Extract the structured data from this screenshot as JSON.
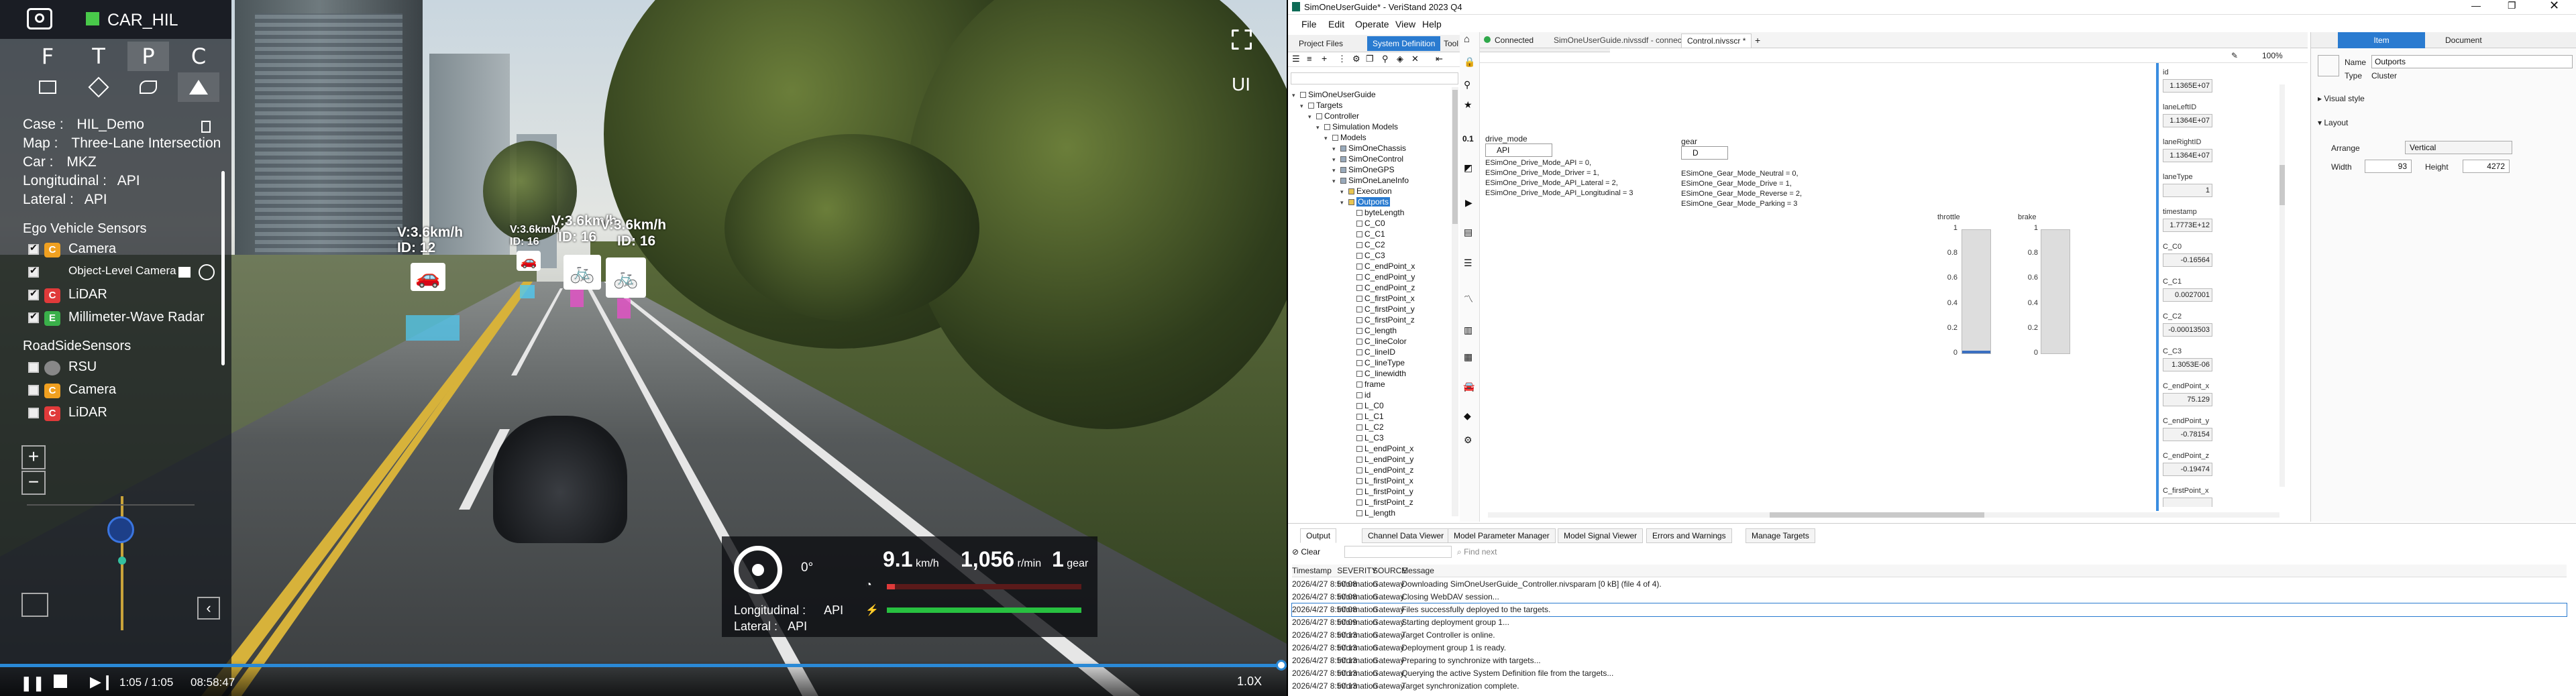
{
  "sim": {
    "camera_name": "CAR_HIL",
    "modes": [
      "F",
      "T",
      "P",
      "C"
    ],
    "info": {
      "case_label": "Case :",
      "case_value": "HIL_Demo",
      "map_label": "Map :",
      "map_value": "Three-Lane Intersection",
      "car_label": "Car :",
      "car_value": "MKZ",
      "long_label": "Longitudinal :",
      "long_value": "API",
      "lat_label": "Lateral :",
      "lat_value": "API"
    },
    "ego_sensors_title": "Ego Vehicle Sensors",
    "ego_sensors": [
      {
        "label": "Camera",
        "checked": true,
        "badge": "C",
        "color": "#f0a020"
      },
      {
        "label": "Object-Level Camera",
        "checked": true,
        "badge": "",
        "color": ""
      },
      {
        "label": "LiDAR",
        "checked": true,
        "badge": "C",
        "color": "#e03a3a"
      },
      {
        "label": "Millimeter-Wave Radar",
        "checked": true,
        "badge": "E",
        "color": "#3ab04a"
      }
    ],
    "roadside_title": "RoadSideSensors",
    "roadside_sensors": [
      {
        "label": "RSU",
        "checked": false,
        "badge": "",
        "color": "#888"
      },
      {
        "label": "Camera",
        "checked": false,
        "badge": "C",
        "color": "#f0a020"
      },
      {
        "label": "LiDAR",
        "checked": false,
        "badge": "C",
        "color": "#e03a3a"
      }
    ],
    "vehicle_tags": [
      {
        "speed": "V:3.6km/h",
        "id": "ID:  12"
      },
      {
        "speed": "V:3.6km/h",
        "id": "ID:  16"
      },
      {
        "speed": "V:3.6km/h",
        "id": "ID:  16"
      },
      {
        "speed": "V:3.6km/h",
        "id": "ID:  16"
      }
    ],
    "ui_label": "UI",
    "hud": {
      "steer_angle": "0°",
      "long_label": "Longitudinal :",
      "long_value": "API",
      "lat_label": "Lateral :",
      "lat_value": "API",
      "speed": "9.1",
      "speed_unit": "km/h",
      "rpm": "1,056",
      "rpm_unit": "r/min",
      "gear": "1",
      "gear_unit": "gear"
    },
    "playback": {
      "time": "1:05 / 1:05",
      "clock": "08:58:47",
      "rate": "1.0X",
      "progress": 1.0
    }
  },
  "vs": {
    "title": "SimOneUserGuide* - VeriStand 2023 Q4",
    "menu": [
      "File",
      "Edit",
      "Operate",
      "View",
      "Help"
    ],
    "left_tabs": [
      "Project Files",
      "System Definition",
      "Tool Launcher"
    ],
    "doc_tabs": {
      "connected": "Connected",
      "sysdef": "SimOneUserGuide.nivssdf - connected",
      "screen": "Control.nivsscr *"
    },
    "zoom": "100%",
    "tree": [
      {
        "label": "SimOneUserGuide",
        "level": 0
      },
      {
        "label": "Targets",
        "level": 1
      },
      {
        "label": "Controller",
        "level": 2
      },
      {
        "label": "Simulation Models",
        "level": 3
      },
      {
        "label": "Models",
        "level": 4
      },
      {
        "label": "SimOneChassis",
        "level": 5
      },
      {
        "label": "SimOneControl",
        "level": 5
      },
      {
        "label": "SimOneGPS",
        "level": 5
      },
      {
        "label": "SimOneLaneInfo",
        "level": 5
      },
      {
        "label": "Execution",
        "level": 6
      },
      {
        "label": "Outports",
        "level": 6,
        "selected": true
      },
      {
        "label": "byteLength",
        "level": 7
      },
      {
        "label": "C_C0",
        "level": 7
      },
      {
        "label": "C_C1",
        "level": 7
      },
      {
        "label": "C_C2",
        "level": 7
      },
      {
        "label": "C_C3",
        "level": 7
      },
      {
        "label": "C_endPoint_x",
        "level": 7
      },
      {
        "label": "C_endPoint_y",
        "level": 7
      },
      {
        "label": "C_endPoint_z",
        "level": 7
      },
      {
        "label": "C_firstPoint_x",
        "level": 7
      },
      {
        "label": "C_firstPoint_y",
        "level": 7
      },
      {
        "label": "C_firstPoint_z",
        "level": 7
      },
      {
        "label": "C_length",
        "level": 7
      },
      {
        "label": "C_lineColor",
        "level": 7
      },
      {
        "label": "C_lineID",
        "level": 7
      },
      {
        "label": "C_lineType",
        "level": 7
      },
      {
        "label": "C_linewidth",
        "level": 7
      },
      {
        "label": "frame",
        "level": 7
      },
      {
        "label": "id",
        "level": 7
      },
      {
        "label": "L_C0",
        "level": 7
      },
      {
        "label": "L_C1",
        "level": 7
      },
      {
        "label": "L_C2",
        "level": 7
      },
      {
        "label": "L_C3",
        "level": 7
      },
      {
        "label": "L_endPoint_x",
        "level": 7
      },
      {
        "label": "L_endPoint_y",
        "level": 7
      },
      {
        "label": "L_endPoint_z",
        "level": 7
      },
      {
        "label": "L_firstPoint_x",
        "level": 7
      },
      {
        "label": "L_firstPoint_y",
        "level": 7
      },
      {
        "label": "L_firstPoint_z",
        "level": 7
      },
      {
        "label": "L_length",
        "level": 7
      }
    ],
    "screen": {
      "drive_mode_label": "drive_mode",
      "drive_mode_value": "API",
      "drive_mode_enum": [
        "ESimOne_Drive_Mode_API = 0,",
        "ESimOne_Drive_Mode_Driver = 1,",
        "ESimOne_Drive_Mode_API_Lateral = 2,",
        "ESimOne_Drive_Mode_API_Longitudinal = 3"
      ],
      "gear_label": "gear",
      "gear_value": "D",
      "gear_enum": [
        "ESimOne_Gear_Mode_Neutral = 0,",
        "ESimOne_Gear_Mode_Drive = 1,",
        "ESimOne_Gear_Mode_Reverse = 2,",
        "ESimOne_Gear_Mode_Parking = 3"
      ],
      "throttle_label": "throttle",
      "brake_label": "brake",
      "scale_ticks": [
        "1",
        "0.8",
        "0.6",
        "0.4",
        "0.2",
        "0"
      ],
      "throttle_level": 0.02,
      "brake_level": 0.0,
      "indicators": [
        {
          "label": "id",
          "value": "1.1365E+07"
        },
        {
          "label": "laneLeftID",
          "value": "1.1364E+07"
        },
        {
          "label": "laneRightID",
          "value": "1.1364E+07"
        },
        {
          "label": "laneType",
          "value": "1"
        },
        {
          "label": "timestamp",
          "value": "1.7773E+12"
        },
        {
          "label": "C_C0",
          "value": "-0.16564"
        },
        {
          "label": "C_C1",
          "value": "0.0027001"
        },
        {
          "label": "C_C2",
          "value": "-0.00013503"
        },
        {
          "label": "C_C3",
          "value": "1.3053E-06"
        },
        {
          "label": "C_endPoint_x",
          "value": "75.129"
        },
        {
          "label": "C_endPoint_y",
          "value": "-0.78154"
        },
        {
          "label": "C_endPoint_z",
          "value": "-0.19474"
        },
        {
          "label": "C_firstPoint_x",
          "value": ""
        }
      ]
    },
    "props": {
      "tabs": [
        "Item",
        "Document"
      ],
      "name_label": "Name",
      "name_value": "Outports",
      "type_label": "Type",
      "type_value": "Cluster",
      "visual_style": "Visual style",
      "layout": "Layout",
      "arrange_label": "Arrange",
      "arrange_value": "Vertical",
      "width_label": "Width",
      "width_value": "93",
      "height_label": "Height",
      "height_value": "4272"
    },
    "bottom_tabs": [
      "Output",
      "Channel Data Viewer",
      "Model Parameter Manager",
      "Model Signal Viewer",
      "Errors and Warnings",
      "Manage Targets"
    ],
    "output": {
      "clear": "Clear",
      "find_next": "Find next",
      "columns": [
        "Timestamp",
        "SEVERITY",
        "SOURCE",
        "Message"
      ],
      "rows": [
        {
          "ts": "2026/4/27 8:50:08",
          "sev": "Information",
          "src": "Gateway",
          "msg": "Downloading SimOneUserGuide_Controller.nivsparam [0 kB] (file 4 of 4)."
        },
        {
          "ts": "2026/4/27 8:50:08",
          "sev": "Information",
          "src": "Gateway",
          "msg": "Closing WebDAV session..."
        },
        {
          "ts": "2026/4/27 8:50:08",
          "sev": "Information",
          "src": "Gateway",
          "msg": "Files successfully deployed to the targets."
        },
        {
          "ts": "2026/4/27 8:50:09",
          "sev": "Information",
          "src": "Gateway",
          "msg": "Starting deployment group 1..."
        },
        {
          "ts": "2026/4/27 8:50:13",
          "sev": "Information",
          "src": "Gateway",
          "msg": "Target Controller is online."
        },
        {
          "ts": "2026/4/27 8:50:13",
          "sev": "Information",
          "src": "Gateway",
          "msg": "Deployment group 1 is ready."
        },
        {
          "ts": "2026/4/27 8:50:13",
          "sev": "Information",
          "src": "Gateway",
          "msg": "Preparing to synchronize with targets..."
        },
        {
          "ts": "2026/4/27 8:50:13",
          "sev": "Information",
          "src": "Gateway",
          "msg": "Querying the active System Definition file from the targets..."
        },
        {
          "ts": "2026/4/27 8:50:13",
          "sev": "Information",
          "src": "Gateway",
          "msg": "Target synchronization complete."
        }
      ]
    }
  }
}
